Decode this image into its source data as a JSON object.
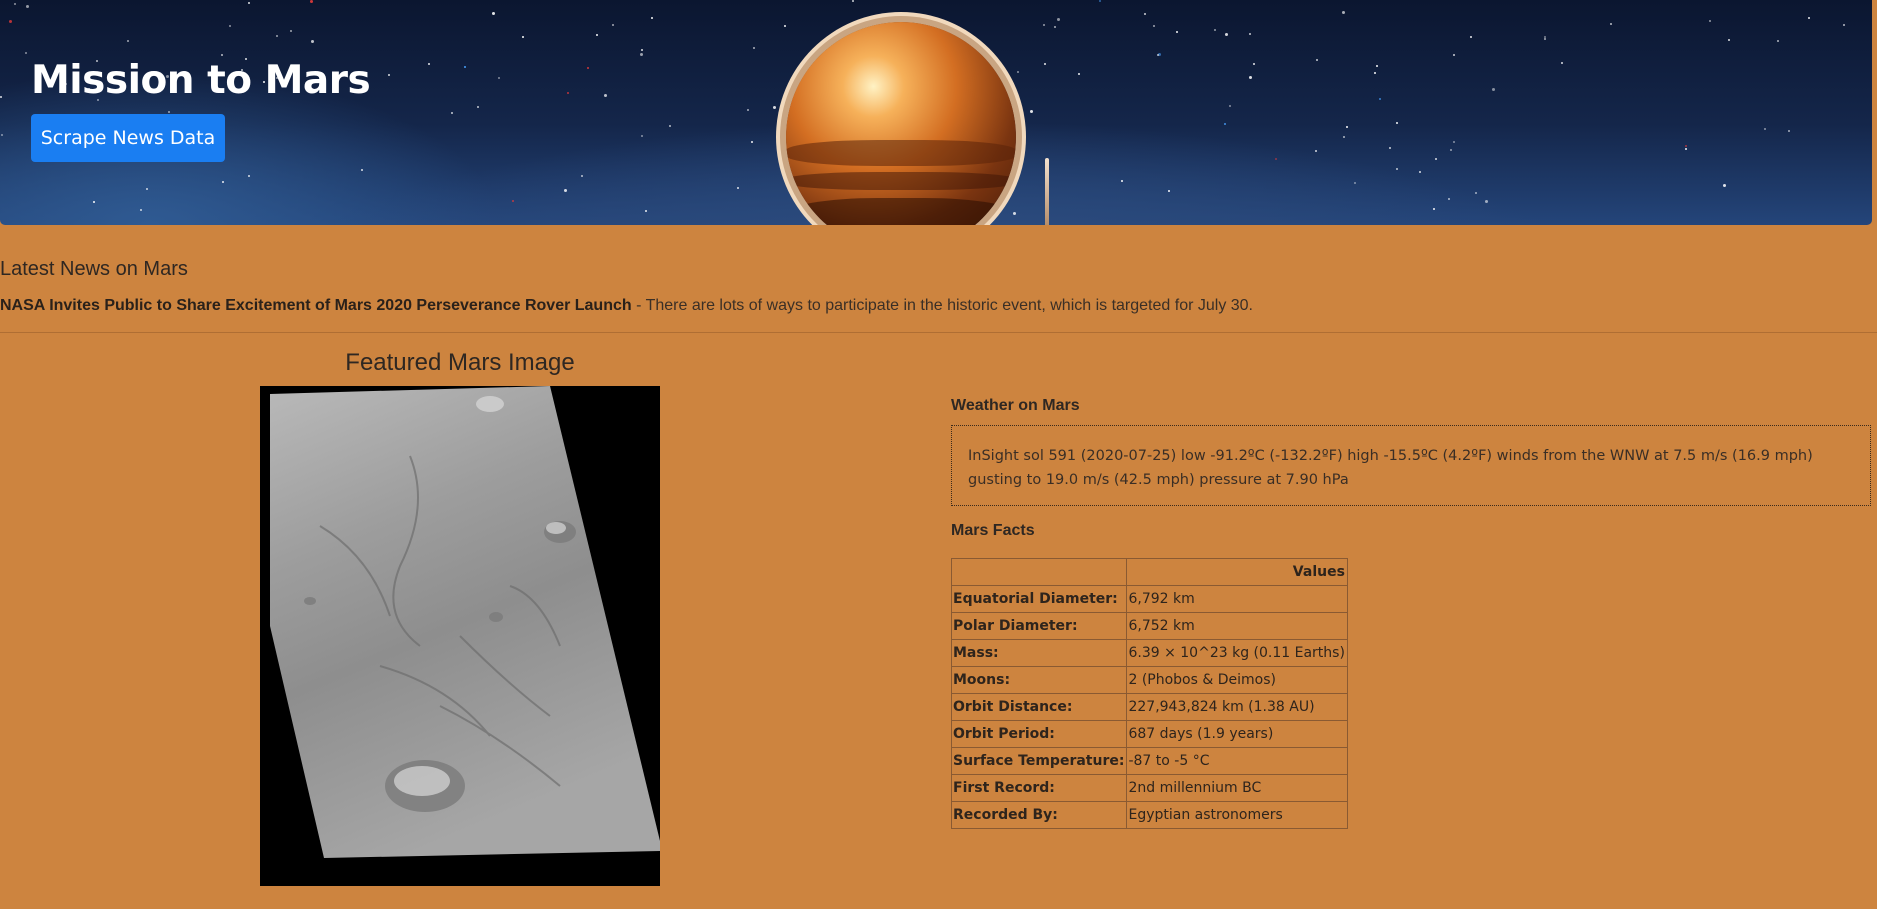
{
  "hero": {
    "title": "Mission to Mars",
    "button_label": "Scrape News Data"
  },
  "news": {
    "heading": "Latest News on Mars",
    "title": "NASA Invites Public to Share Excitement of Mars 2020 Perseverance Rover Launch",
    "separator": " - ",
    "paragraph": "There are lots of ways to participate in the historic event, which is targeted for July 30."
  },
  "featured": {
    "heading": "Featured Mars Image"
  },
  "weather": {
    "heading": "Weather on Mars",
    "text": "InSight sol 591 (2020-07-25) low -91.2ºC (-132.2ºF) high -15.5ºC (4.2ºF) winds from the WNW at 7.5 m/s (16.9 mph) gusting to 19.0 m/s (42.5 mph) pressure at 7.90 hPa"
  },
  "facts": {
    "heading": "Mars Facts",
    "column_header": "Values",
    "rows": [
      {
        "label": "Equatorial Diameter:",
        "value": "6,792 km"
      },
      {
        "label": "Polar Diameter:",
        "value": "6,752 km"
      },
      {
        "label": "Mass:",
        "value": "6.39 × 10^23 kg (0.11 Earths)"
      },
      {
        "label": "Moons:",
        "value": "2 (Phobos & Deimos)"
      },
      {
        "label": "Orbit Distance:",
        "value": "227,943,824 km (1.38 AU)"
      },
      {
        "label": "Orbit Period:",
        "value": "687 days (1.9 years)"
      },
      {
        "label": "Surface Temperature:",
        "value": "-87 to -5 °C"
      },
      {
        "label": "First Record:",
        "value": "2nd millennium BC"
      },
      {
        "label": "Recorded By:",
        "value": "Egyptian astronomers"
      }
    ]
  },
  "colors": {
    "page_background": "#cd843f",
    "button_primary": "#1a7ef2",
    "hero_text": "#ffffff"
  },
  "icons": [
    "astronaut-helmet-image",
    "mars-surface-image"
  ]
}
